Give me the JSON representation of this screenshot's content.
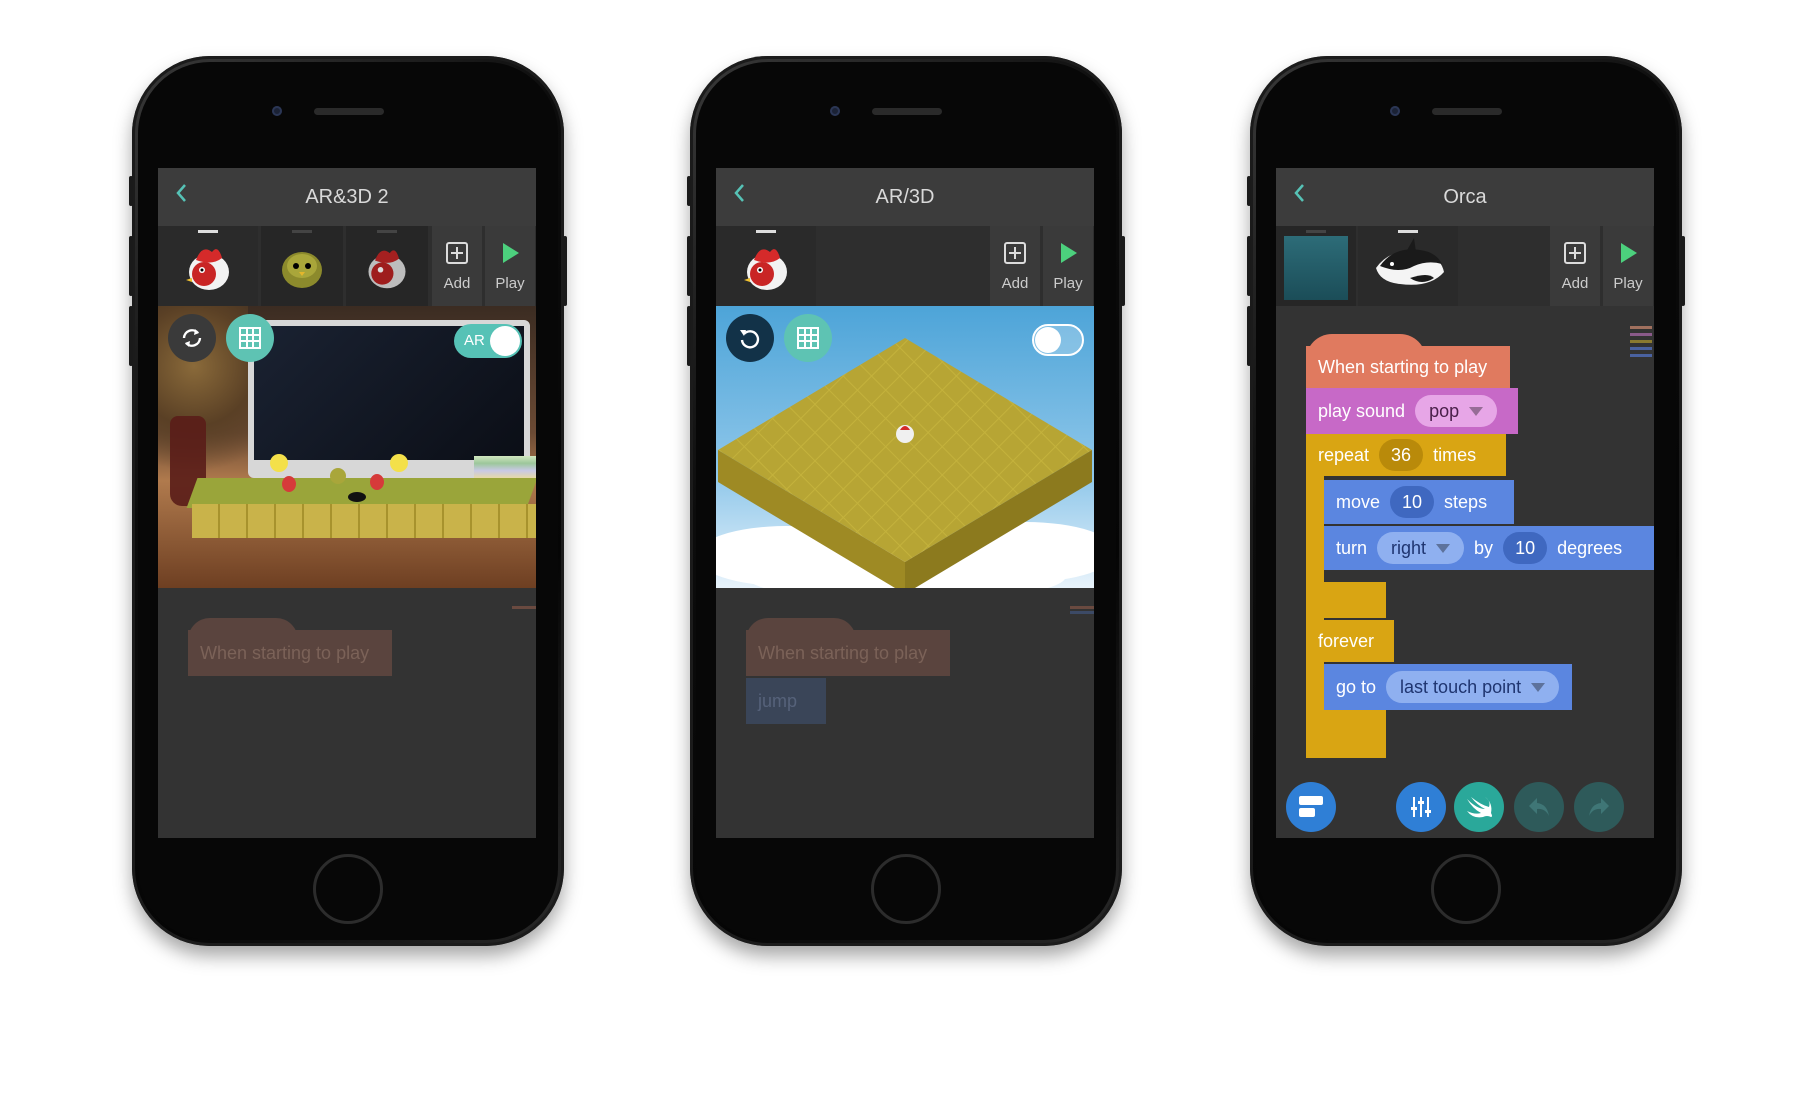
{
  "phones": [
    {
      "title": "AR&3D 2",
      "tools": {
        "add": "Add",
        "play": "Play"
      },
      "ar_label": "AR",
      "ghost_block": "When starting to play"
    },
    {
      "title": "AR/3D",
      "tools": {
        "add": "Add",
        "play": "Play"
      },
      "ghost_blocks": [
        "When starting to play",
        "jump"
      ]
    },
    {
      "title": "Orca",
      "tools": {
        "add": "Add",
        "play": "Play"
      },
      "blocks": {
        "hat": "When starting to play",
        "play_sound": {
          "label": "play sound",
          "value": "pop"
        },
        "repeat": {
          "label": "repeat",
          "value": "36",
          "suffix": "times"
        },
        "move": {
          "label": "move",
          "value": "10",
          "suffix": "steps"
        },
        "turn": {
          "label": "turn",
          "direction": "right",
          "by": "by",
          "value": "10",
          "suffix": "degrees"
        },
        "forever": "forever",
        "go_to": {
          "label": "go to",
          "value": "last touch point"
        }
      }
    }
  ],
  "colors": {
    "accent": "#56c2b6",
    "event": "#e07a5f",
    "sound": "#c769c7",
    "control": "#d9a513",
    "motion": "#5b86e0",
    "play": "#4cd07d"
  }
}
